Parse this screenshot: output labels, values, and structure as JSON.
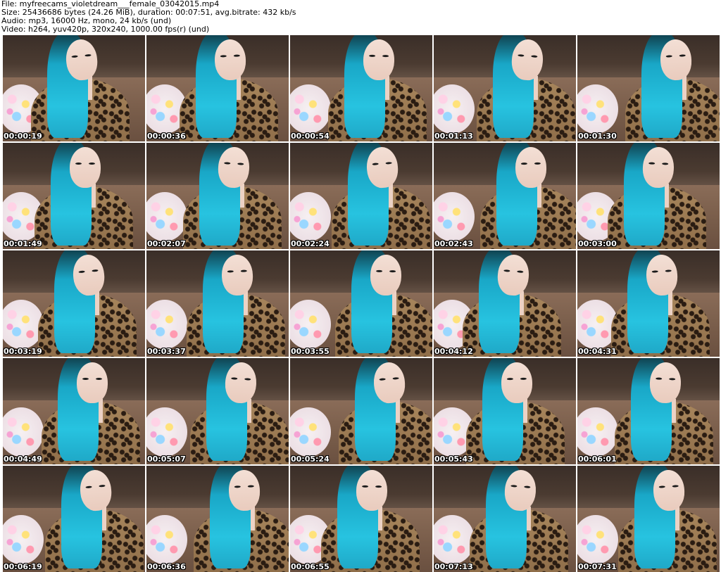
{
  "header": {
    "file": "File: myfreecams_violetdream___female_03042015.mp4",
    "size": "Size: 25436686 bytes (24.26 MiB), duration: 00:07:51, avg.bitrate: 432 kb/s",
    "audio": "Audio: mp3, 16000 Hz, mono, 24 kb/s (und)",
    "video": "Video: h264, yuv420p, 320x240, 1000.00 fps(r) (und)"
  },
  "thumbnails": [
    {
      "timestamp": "00:00:19"
    },
    {
      "timestamp": "00:00:36"
    },
    {
      "timestamp": "00:00:54"
    },
    {
      "timestamp": "00:01:13"
    },
    {
      "timestamp": "00:01:30"
    },
    {
      "timestamp": "00:01:49"
    },
    {
      "timestamp": "00:02:07"
    },
    {
      "timestamp": "00:02:24"
    },
    {
      "timestamp": "00:02:43"
    },
    {
      "timestamp": "00:03:00"
    },
    {
      "timestamp": "00:03:19"
    },
    {
      "timestamp": "00:03:37"
    },
    {
      "timestamp": "00:03:55"
    },
    {
      "timestamp": "00:04:12"
    },
    {
      "timestamp": "00:04:31"
    },
    {
      "timestamp": "00:04:49"
    },
    {
      "timestamp": "00:05:07"
    },
    {
      "timestamp": "00:05:24"
    },
    {
      "timestamp": "00:05:43"
    },
    {
      "timestamp": "00:06:01"
    },
    {
      "timestamp": "00:06:19"
    },
    {
      "timestamp": "00:06:36"
    },
    {
      "timestamp": "00:06:55"
    },
    {
      "timestamp": "00:07:13"
    },
    {
      "timestamp": "00:07:31"
    }
  ],
  "colors": {
    "background": "#ffffff",
    "header_text": "#000000",
    "timestamp_text": "#ffffff",
    "hair": "#27c3e0"
  }
}
